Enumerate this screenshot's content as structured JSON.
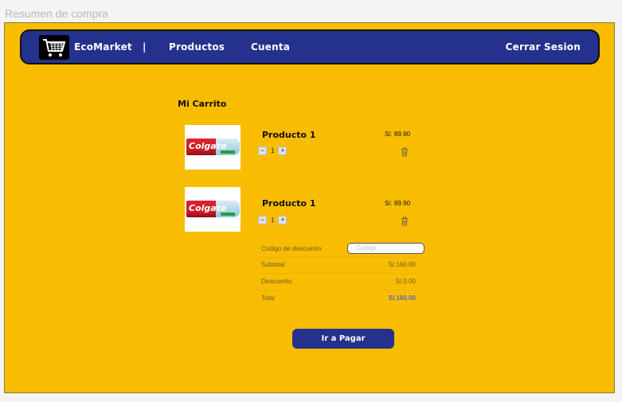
{
  "window": {
    "title": "Resumen de compra"
  },
  "navbar": {
    "brand": "EcoMarket",
    "separator": "|",
    "products": "Productos",
    "account": "Cuenta",
    "logout": "Cerrar Sesion",
    "logo_icon": "shopping-cart-icon",
    "colors": {
      "bar": "#24328e",
      "page": "#f8bd00"
    }
  },
  "cart": {
    "title": "Mi Carrito",
    "items": [
      {
        "name": "Producto 1",
        "price": "S/. 89.90",
        "qty": "1",
        "image_text": "Colgate"
      },
      {
        "name": "Producto 1",
        "price": "S/. 89.90",
        "qty": "1",
        "image_text": "Colgate"
      }
    ]
  },
  "summary": {
    "discount_code_label": "Codigo de descuento",
    "discount_code_placeholder": "Codigo",
    "subtotal_label": "Subtotal",
    "subtotal_value": "S/.160.00",
    "discount_label": "Descuento",
    "discount_value": "S/.0.00",
    "total_label": "Total",
    "total_value": "S/.160.00"
  },
  "checkout": {
    "pay_label": "Ir a Pagar"
  }
}
